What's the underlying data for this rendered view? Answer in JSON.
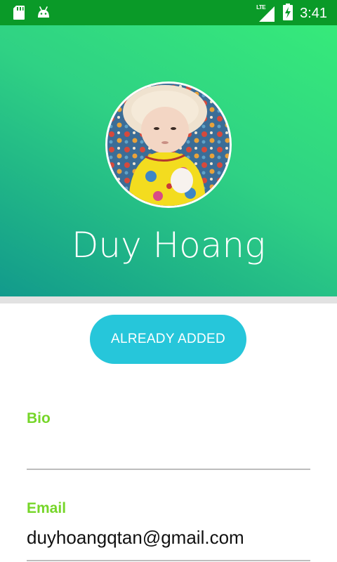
{
  "status_bar": {
    "time": "3:41",
    "network": "LTE",
    "left_icons": [
      "sd-card-icon",
      "android-icon"
    ],
    "right_icons": [
      "signal-icon",
      "battery-charging-icon"
    ]
  },
  "header": {
    "name": "Duy Hoang",
    "avatar": "profile-photo",
    "gradient_colors": [
      "#36ea7a",
      "#129a8c"
    ]
  },
  "action_button": {
    "label": "ALREADY ADDED",
    "color": "#26c6da"
  },
  "fields": {
    "bio": {
      "label": "Bio",
      "value": ""
    },
    "email": {
      "label": "Email",
      "value": "duyhoangqtan@gmail.com"
    }
  },
  "colors": {
    "status_bar": "#0a9a28",
    "label_accent": "#76d629"
  }
}
